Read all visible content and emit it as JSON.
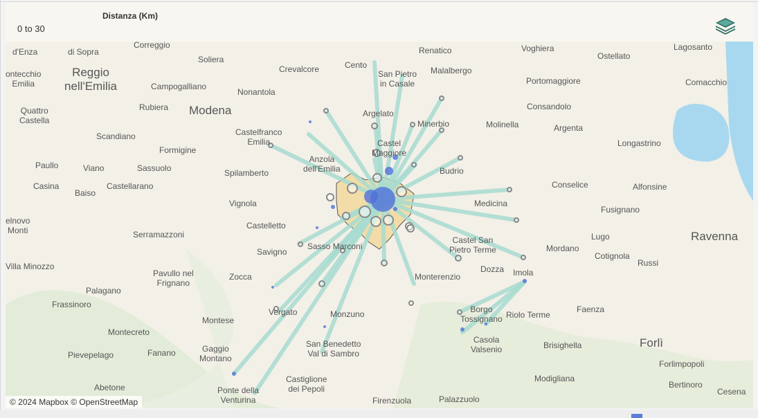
{
  "legend": {
    "title": "Distanza (Km)",
    "value": "0 to 30"
  },
  "layers_button": {
    "icon": "layers-icon"
  },
  "attribution": "© 2024 Mapbox © OpenStreetMap",
  "colors": {
    "line": "#a8dcd1",
    "dot": "#5070d8",
    "ring": "#888888",
    "area": "#f2dca8"
  },
  "places": [
    {
      "name": "d'Enza",
      "cls": ""
    },
    {
      "name": "di Sopra",
      "cls": ""
    },
    {
      "name": "Correggio",
      "cls": ""
    },
    {
      "name": "Renatico",
      "cls": ""
    },
    {
      "name": "Voghiera",
      "cls": ""
    },
    {
      "name": "Ostellato",
      "cls": ""
    },
    {
      "name": "Lagosanto",
      "cls": ""
    },
    {
      "name": "Soliera",
      "cls": ""
    },
    {
      "name": "Reggio\nnell'Emilia",
      "cls": "big"
    },
    {
      "name": "Crevalcore",
      "cls": ""
    },
    {
      "name": "Cento",
      "cls": ""
    },
    {
      "name": "San Pietro\nin Casale",
      "cls": ""
    },
    {
      "name": "Malalbergo",
      "cls": ""
    },
    {
      "name": "ontecchio\nEmilia",
      "cls": ""
    },
    {
      "name": "Campogalliano",
      "cls": ""
    },
    {
      "name": "Nonantola",
      "cls": ""
    },
    {
      "name": "Portomaggiore",
      "cls": ""
    },
    {
      "name": "Comacchio",
      "cls": ""
    },
    {
      "name": "Rubiera",
      "cls": ""
    },
    {
      "name": "Modena",
      "cls": "big"
    },
    {
      "name": "Consandolo",
      "cls": ""
    },
    {
      "name": "Quattro\nCastella",
      "cls": ""
    },
    {
      "name": "Argelato",
      "cls": ""
    },
    {
      "name": "Minerbio",
      "cls": ""
    },
    {
      "name": "Molinella",
      "cls": ""
    },
    {
      "name": "Argenta",
      "cls": ""
    },
    {
      "name": "Scandiano",
      "cls": ""
    },
    {
      "name": "Castelfranco\nEmilia",
      "cls": ""
    },
    {
      "name": "Castel\nMaggiore",
      "cls": ""
    },
    {
      "name": "Formigine",
      "cls": ""
    },
    {
      "name": "Longastrino",
      "cls": ""
    },
    {
      "name": "Paullo",
      "cls": ""
    },
    {
      "name": "Viano",
      "cls": ""
    },
    {
      "name": "Sassuolo",
      "cls": ""
    },
    {
      "name": "Anzola\ndell'Emilia",
      "cls": ""
    },
    {
      "name": "Budrio",
      "cls": ""
    },
    {
      "name": "Spilamberto",
      "cls": ""
    },
    {
      "name": "Casina",
      "cls": ""
    },
    {
      "name": "Baiso",
      "cls": ""
    },
    {
      "name": "Castellarano",
      "cls": ""
    },
    {
      "name": "Conselice",
      "cls": ""
    },
    {
      "name": "Alfonsine",
      "cls": ""
    },
    {
      "name": "Medicina",
      "cls": ""
    },
    {
      "name": "Vignola",
      "cls": ""
    },
    {
      "name": "Fusignano",
      "cls": ""
    },
    {
      "name": "elnovo\nMonti",
      "cls": ""
    },
    {
      "name": "Castelletto",
      "cls": ""
    },
    {
      "name": "Serramazzoni",
      "cls": ""
    },
    {
      "name": "Lugo",
      "cls": ""
    },
    {
      "name": "Ravenna",
      "cls": "big"
    },
    {
      "name": "Castel San\nPietro Terme",
      "cls": ""
    },
    {
      "name": "Savigno",
      "cls": ""
    },
    {
      "name": "Sasso Marconi",
      "cls": ""
    },
    {
      "name": "Mordano",
      "cls": ""
    },
    {
      "name": "Cotignola",
      "cls": ""
    },
    {
      "name": "Russi",
      "cls": ""
    },
    {
      "name": "Villa Minozzo",
      "cls": ""
    },
    {
      "name": "Pavullo nel\nFrignano",
      "cls": ""
    },
    {
      "name": "Dozza",
      "cls": ""
    },
    {
      "name": "Imola",
      "cls": ""
    },
    {
      "name": "Zocca",
      "cls": ""
    },
    {
      "name": "Monterenzio",
      "cls": ""
    },
    {
      "name": "Palagano",
      "cls": ""
    },
    {
      "name": "Frassinoro",
      "cls": ""
    },
    {
      "name": "Vergato",
      "cls": ""
    },
    {
      "name": "Borgo\nTossignano",
      "cls": ""
    },
    {
      "name": "Faenza",
      "cls": ""
    },
    {
      "name": "Monzuno",
      "cls": ""
    },
    {
      "name": "Riolo Terme",
      "cls": ""
    },
    {
      "name": "Montese",
      "cls": ""
    },
    {
      "name": "Montecreto",
      "cls": ""
    },
    {
      "name": "Casola\nValsenio",
      "cls": ""
    },
    {
      "name": "Forlì",
      "cls": "big"
    },
    {
      "name": "San Benedetto\nVal di Sambro",
      "cls": ""
    },
    {
      "name": "Brisighella",
      "cls": ""
    },
    {
      "name": "Pievepelago",
      "cls": ""
    },
    {
      "name": "Fanano",
      "cls": ""
    },
    {
      "name": "Gaggio\nMontano",
      "cls": ""
    },
    {
      "name": "Forlimpopoli",
      "cls": ""
    },
    {
      "name": "Modigliana",
      "cls": ""
    },
    {
      "name": "Abetone",
      "cls": ""
    },
    {
      "name": "Castiglione\ndei Pepoli",
      "cls": ""
    },
    {
      "name": "Bertinoro",
      "cls": ""
    },
    {
      "name": "Ponte della\nVenturina",
      "cls": ""
    },
    {
      "name": "Firenzuola",
      "cls": ""
    },
    {
      "name": "Palazzuolo",
      "cls": ""
    },
    {
      "name": "Cesena",
      "cls": ""
    }
  ]
}
